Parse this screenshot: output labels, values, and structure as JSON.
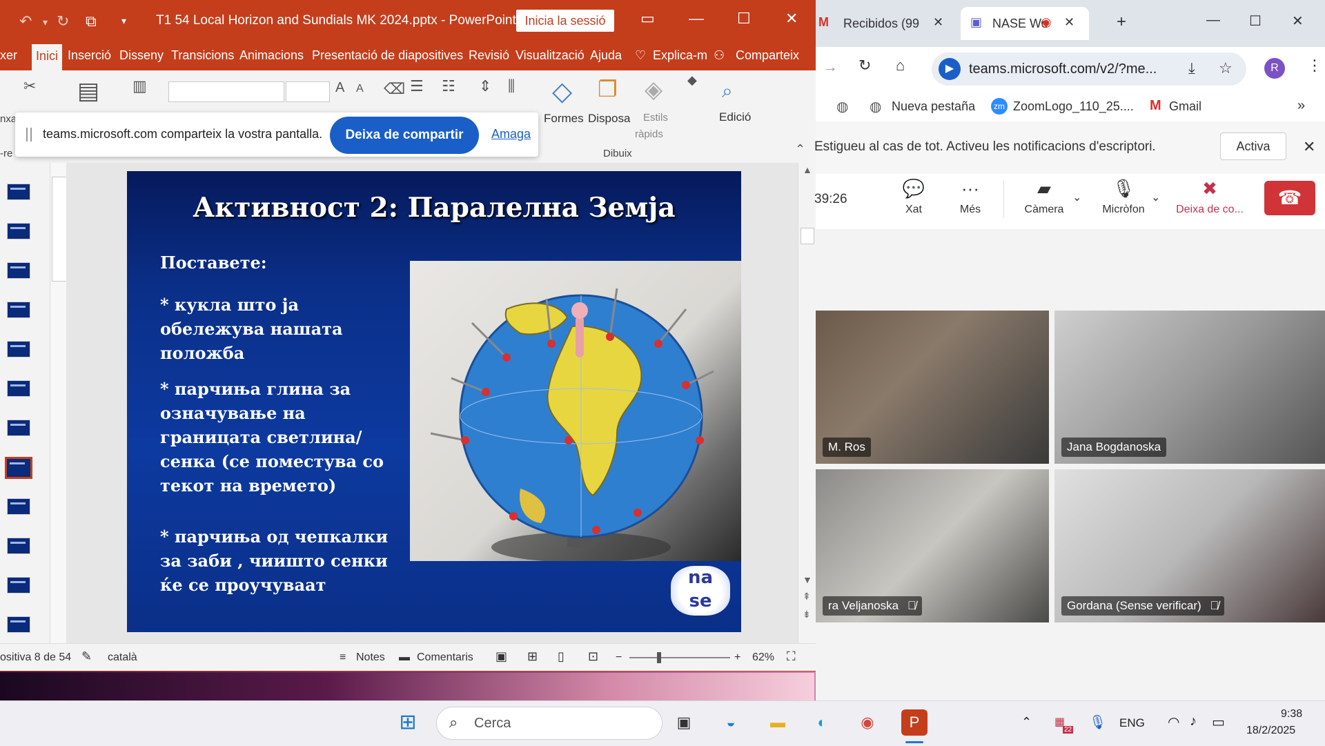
{
  "powerpoint": {
    "title": "T1 54 Local Horizon and Sundials MK 2024.pptx  -  PowerPoint",
    "session_button": "Inicia la sessió",
    "tabs": [
      "xer",
      "Inici",
      "Inserció",
      "Disseny",
      "Transicions",
      "Animacions",
      "Presentació de diapositives",
      "Revisió",
      "Visualització",
      "Ajuda",
      "Explica-m",
      "Comparteix"
    ],
    "ribbon": {
      "shapes": "Formes",
      "arrange": "Disposa",
      "quick_styles_1": "Estils",
      "quick_styles_2": "ràpids",
      "editing": "Edició",
      "drawing_group": "Dibuix",
      "left_cut": "nxa",
      "left_cut2": "-re"
    },
    "share_bar": {
      "text": "teams.microsoft.com comparteix la vostra pantalla.",
      "stop_button": "Deixa de compartir",
      "hide_link": "Amaga"
    },
    "slide": {
      "title": "Активност 2: Паралелна Земја",
      "heading": "Поставете:",
      "bullets": [
        "* кукла што ја обележува нашата положба",
        "* парчиња глина за означување на границата светлина/сенка (се поместува со текот на времето)",
        "* парчиња од чепкалки за заби , чиишто сенки ќе се проучуваат"
      ],
      "logo_text_1": "na",
      "logo_text_2": "se"
    },
    "status": {
      "slide_counter": "ositiva 8 de 54",
      "language": "català",
      "notes": "Notes",
      "comments": "Comentaris",
      "zoom": "62%"
    }
  },
  "chrome": {
    "tabs": [
      {
        "label": "Recibidos (99",
        "icon": "gmail-icon"
      },
      {
        "label": "NASE Wo",
        "icon": "teams-icon"
      }
    ],
    "url": "teams.microsoft.com/v2/?me...",
    "profile_initial": "R",
    "bookmarks": [
      "Nueva pestaña",
      "ZoomLogo_110_25....",
      "Gmail"
    ],
    "notification": {
      "text": "Estigueu al cas de tot. Activeu les notificacions d'escriptori.",
      "button": "Activa"
    }
  },
  "teams": {
    "timer": "39:26",
    "controls": [
      "Xat",
      "Més",
      "Càmera",
      "Micròfon",
      "Deixa de co..."
    ],
    "participants": [
      {
        "name": "M. Ros"
      },
      {
        "name": "Jana Bogdanoska"
      },
      {
        "name": "ra Veljanoska"
      },
      {
        "name": "Gordana (Sense verificar)"
      }
    ]
  },
  "taskbar": {
    "search_placeholder": "Cerca",
    "language": "ENG",
    "time": "9:38",
    "date": "18/2/2025",
    "calendar_badge": "22"
  },
  "colors": {
    "ppt_brand": "#c43e1c",
    "teams_hangup": "#d13438",
    "share_button": "#1a5fc8",
    "slide_bg": "#0a2f88"
  }
}
